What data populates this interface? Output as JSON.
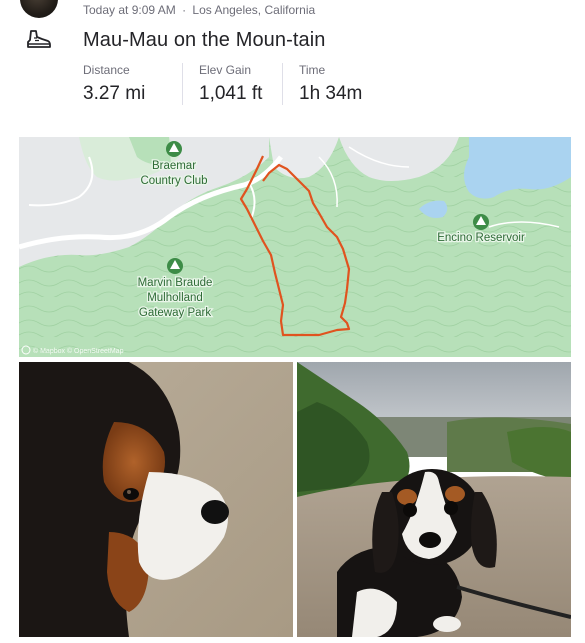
{
  "activity": {
    "timestamp": "Today at 9:09 AM",
    "separator": "·",
    "location": "Los Angeles, California",
    "title": "Mau-Mau on the Moun-tain",
    "sport_icon": "hiking-boot-icon"
  },
  "stats": [
    {
      "label": "Distance",
      "value": "3.27 mi"
    },
    {
      "label": "Elev Gain",
      "value": "1,041 ft"
    },
    {
      "label": "Time",
      "value": "1h 34m"
    }
  ],
  "map": {
    "places": [
      {
        "line1": "Braemar",
        "line2": "Country Club",
        "line3": ""
      },
      {
        "line1": "Encino Reservoir",
        "line2": "",
        "line3": ""
      },
      {
        "line1": "Marvin Braude",
        "line2": "Mulholland",
        "line3": "Gateway Park"
      }
    ],
    "attribution": "© Mapbox © OpenStreetMap",
    "route_color": "#e0531f",
    "park_color": "#b7e0b9",
    "water_color": "#aad3f0"
  },
  "photos": [
    {
      "subject": "dog-closeup-photo"
    },
    {
      "subject": "dog-on-mountain-photo"
    }
  ]
}
